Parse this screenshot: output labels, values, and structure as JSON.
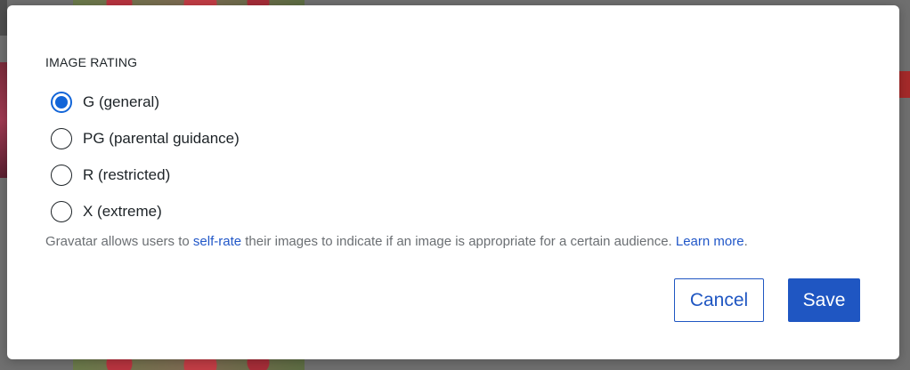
{
  "dialog": {
    "section_title": "IMAGE RATING",
    "rating_options": [
      {
        "label": "G (general)",
        "checked": true
      },
      {
        "label": "PG (parental guidance)",
        "checked": false
      },
      {
        "label": "R (restricted)",
        "checked": false
      },
      {
        "label": "X (extreme)",
        "checked": false
      }
    ],
    "help": {
      "prefix": "Gravatar allows users to ",
      "self_rate_link": "self-rate",
      "middle": " their images to indicate if an image is appropriate for a certain audience. ",
      "learn_more_link": "Learn more",
      "suffix": "."
    },
    "buttons": {
      "cancel_label": "Cancel",
      "save_label": "Save"
    }
  },
  "colors": {
    "accent": "#1f56c2",
    "radio_checked": "#1265d8",
    "help_text": "#6b6f73",
    "backdrop": "#6f6f6f"
  }
}
